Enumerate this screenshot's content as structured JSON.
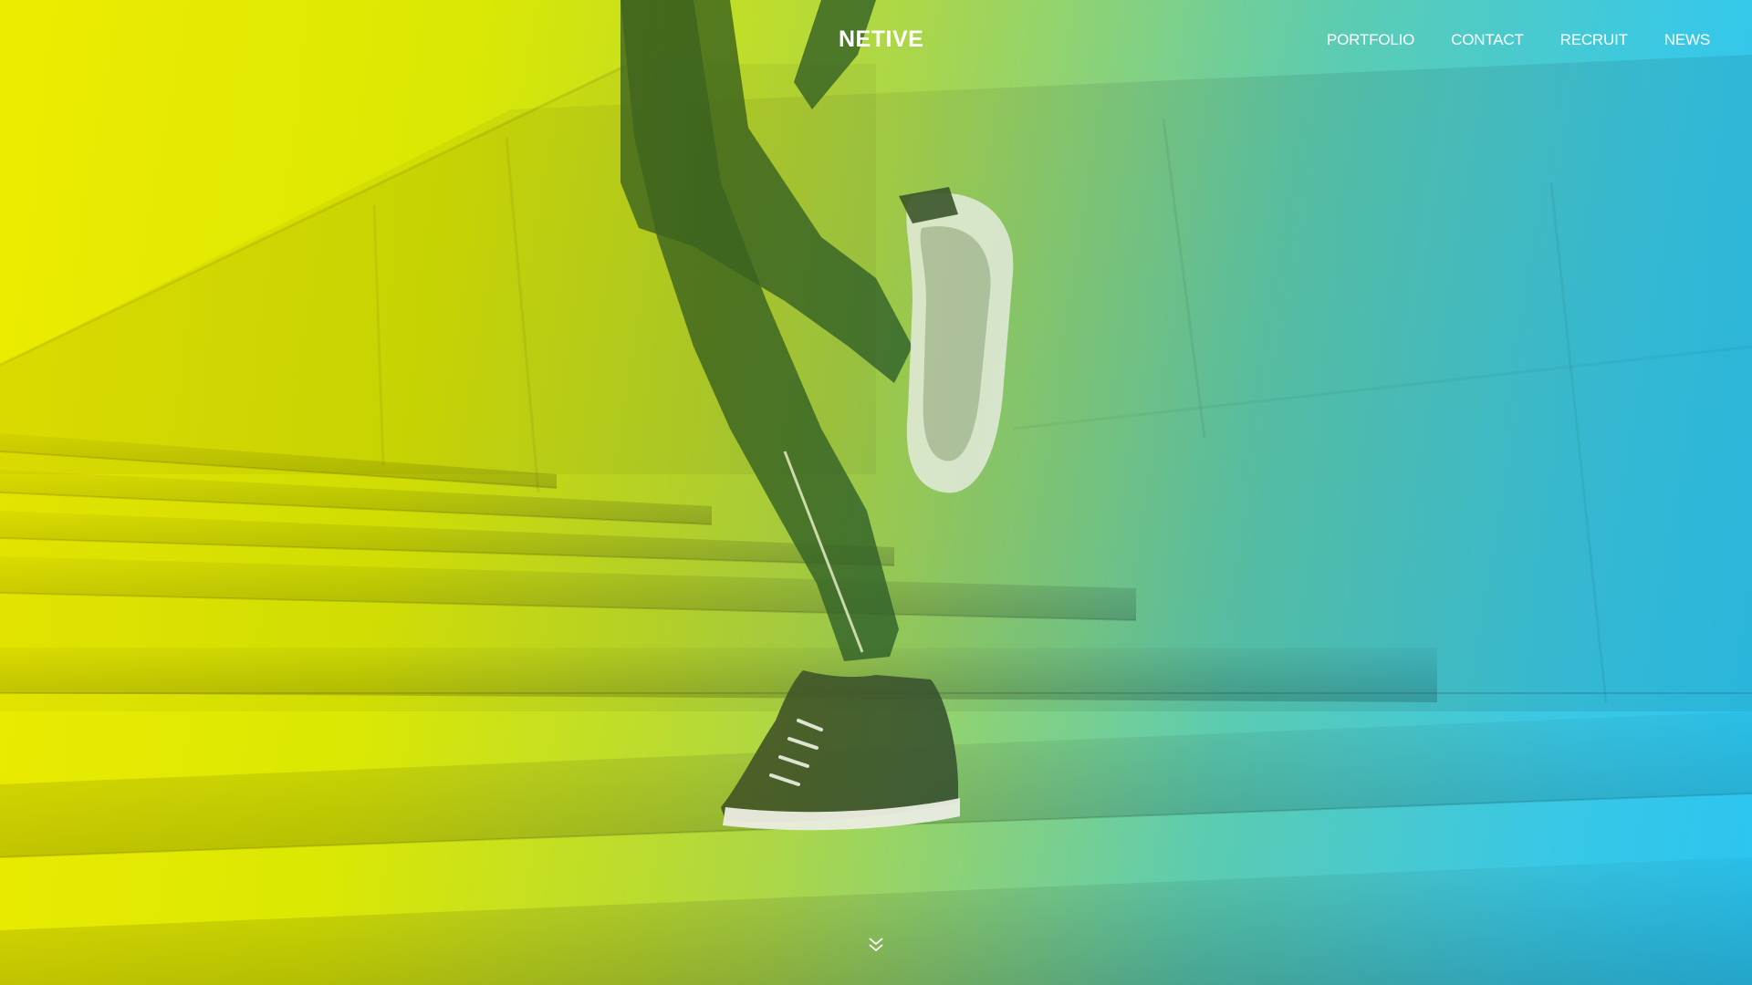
{
  "brand": {
    "logo_text": "NETIVE"
  },
  "nav": {
    "items": [
      {
        "label": "PORTFOLIO"
      },
      {
        "label": "CONTACT"
      },
      {
        "label": "RECRUIT"
      },
      {
        "label": "NEWS"
      }
    ]
  },
  "hero": {
    "scroll_icon": "double-chevron-down-icon",
    "gradient_colors": [
      "#e5e300",
      "#9ccc3d",
      "#52c0a0",
      "#20b2ea"
    ]
  }
}
